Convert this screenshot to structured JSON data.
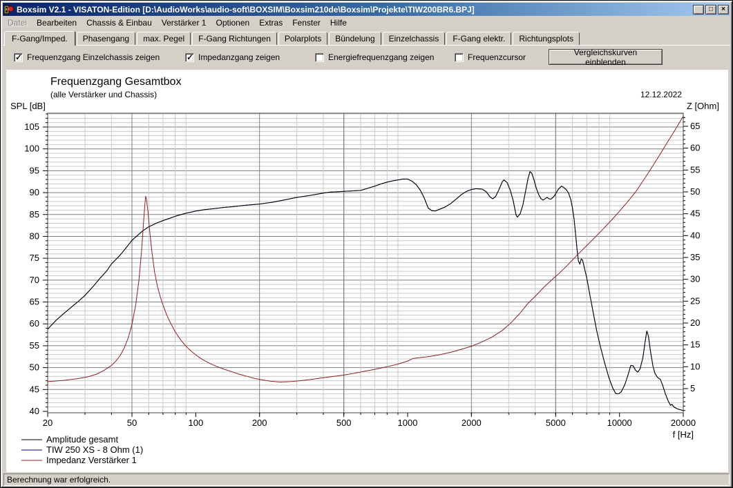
{
  "window": {
    "title": "Boxsim V2.1 - VISATON-Edition [D:\\AudioWorks\\audio-soft\\BOXSIM\\Boxsim210de\\Boxsim\\Projekte\\TIW200BR6.BPJ]",
    "controls": {
      "minimize": "_",
      "maximize": "□",
      "close": "×"
    }
  },
  "menu": {
    "items": [
      {
        "label": "Datei",
        "enabled": false
      },
      {
        "label": "Bearbeiten",
        "enabled": true
      },
      {
        "label": "Chassis & Einbau",
        "enabled": true
      },
      {
        "label": "Verstärker 1",
        "enabled": true
      },
      {
        "label": "Optionen",
        "enabled": true
      },
      {
        "label": "Extras",
        "enabled": true
      },
      {
        "label": "Fenster",
        "enabled": true
      },
      {
        "label": "Hilfe",
        "enabled": true
      }
    ]
  },
  "tabs": {
    "active_index": 0,
    "items": [
      "F-Gang/Imped.",
      "Phasengang",
      "max. Pegel",
      "F-Gang Richtungen",
      "Polarplots",
      "Bündelung",
      "Einzelchassis",
      "F-Gang elektr.",
      "Richtungsplots"
    ]
  },
  "controls": {
    "checkboxes": [
      {
        "label": "Frequenzgang Einzelchassis zeigen",
        "checked": true,
        "x": 16
      },
      {
        "label": "Impedanzgang zeigen",
        "checked": true,
        "x": 264
      },
      {
        "label": "Energiefrequenzgang zeigen",
        "checked": false,
        "x": 452
      },
      {
        "label": "Frequenzcursor",
        "checked": false,
        "x": 654
      }
    ],
    "compare_button": "Vergleichskurven einblenden"
  },
  "chart": {
    "title": "Frequenzgang Gesamtbox",
    "subtitle": "(alle Verstärker und Chassis)",
    "date": "12.12.2022",
    "y_left_label": "SPL [dB]",
    "y_right_label": "Z [Ohm]",
    "x_label": "f [Hz]"
  },
  "legend": {
    "items": [
      {
        "label": "Amplitude gesamt",
        "color": "#000000"
      },
      {
        "label": "TIW 250 XS - 8 Ohm (1)",
        "color": "#000080"
      },
      {
        "label": "Impedanz Verstärker 1",
        "color": "#8b2020"
      }
    ]
  },
  "status_bar": {
    "text": "Berechnung war erfolgreich."
  },
  "colors": {
    "window_bg": "#d4d0c8",
    "titlebar_left": "#0a246a",
    "titlebar_right": "#a6caf0",
    "chart_bg": "#ffffff",
    "grid_minor": "#c9c9c9",
    "grid_major": "#7d7d7d",
    "amplitude": "#000000",
    "chassis": "#000080",
    "impedance": "#8b2020"
  },
  "chart_data": {
    "type": "line",
    "title": "Frequenzgang Gesamtbox",
    "subtitle": "(alle Verstärker und Chassis)",
    "x_scale": "log",
    "x_range": [
      20,
      20000
    ],
    "x_ticks": [
      20,
      50,
      100,
      200,
      500,
      1000,
      2000,
      5000,
      10000,
      20000
    ],
    "xlabel": "f [Hz]",
    "y_left": {
      "label": "SPL [dB]",
      "tick_min": 40,
      "tick_max": 105,
      "tick_step": 5,
      "minor_step": 1
    },
    "y_right": {
      "label": "Z [Ohm]",
      "tick_min": 5,
      "tick_max": 65,
      "tick_step": 5,
      "minor_step": 1
    },
    "grid": true,
    "legend_position": "bottom-left",
    "series": [
      {
        "id": "tiw",
        "name": "TIW 250 XS - 8 Ohm (1)",
        "axis": "left",
        "color": "#000080",
        "points_ref": "amplitude",
        "note": "single-chassis curve coincides with total amplitude"
      },
      {
        "id": "amplitude",
        "name": "Amplitude gesamt",
        "axis": "left",
        "color": "#000000",
        "points": [
          [
            20,
            58.8
          ],
          [
            22,
            60.9
          ],
          [
            24,
            62.5
          ],
          [
            26,
            63.9
          ],
          [
            28,
            65.2
          ],
          [
            30,
            66.5
          ],
          [
            33,
            68.7
          ],
          [
            35,
            70.2
          ],
          [
            38,
            72.1
          ],
          [
            40,
            73.7
          ],
          [
            43,
            75.2
          ],
          [
            45,
            76.3
          ],
          [
            48,
            78.0
          ],
          [
            50,
            79.1
          ],
          [
            53,
            80.2
          ],
          [
            56,
            81.2
          ],
          [
            60,
            82.2
          ],
          [
            65,
            83.0
          ],
          [
            70,
            83.6
          ],
          [
            75,
            84.1
          ],
          [
            80,
            84.6
          ],
          [
            90,
            85.3
          ],
          [
            100,
            85.8
          ],
          [
            110,
            86.1
          ],
          [
            120,
            86.3
          ],
          [
            135,
            86.6
          ],
          [
            150,
            86.8
          ],
          [
            170,
            87.1
          ],
          [
            200,
            87.4
          ],
          [
            230,
            87.8
          ],
          [
            260,
            88.3
          ],
          [
            300,
            88.9
          ],
          [
            350,
            89.4
          ],
          [
            400,
            89.9
          ],
          [
            430,
            90.1
          ],
          [
            470,
            90.2
          ],
          [
            500,
            90.3
          ],
          [
            550,
            90.4
          ],
          [
            600,
            90.5
          ],
          [
            650,
            91.0
          ],
          [
            700,
            91.5
          ],
          [
            750,
            92.0
          ],
          [
            800,
            92.4
          ],
          [
            850,
            92.7
          ],
          [
            900,
            92.9
          ],
          [
            950,
            93.1
          ],
          [
            1000,
            93.1
          ],
          [
            1050,
            92.6
          ],
          [
            1100,
            91.8
          ],
          [
            1150,
            90.5
          ],
          [
            1200,
            88.7
          ],
          [
            1250,
            86.5
          ],
          [
            1300,
            85.9
          ],
          [
            1350,
            85.8
          ],
          [
            1400,
            86.1
          ],
          [
            1500,
            86.7
          ],
          [
            1600,
            87.5
          ],
          [
            1700,
            88.6
          ],
          [
            1800,
            89.6
          ],
          [
            1900,
            90.3
          ],
          [
            2000,
            90.7
          ],
          [
            2100,
            90.9
          ],
          [
            2250,
            90.8
          ],
          [
            2350,
            90.2
          ],
          [
            2450,
            89.0
          ],
          [
            2520,
            88.6
          ],
          [
            2600,
            89.1
          ],
          [
            2700,
            90.7
          ],
          [
            2800,
            92.5
          ],
          [
            2850,
            92.9
          ],
          [
            2950,
            92.3
          ],
          [
            3050,
            90.6
          ],
          [
            3150,
            88.2
          ],
          [
            3250,
            84.9
          ],
          [
            3300,
            84.4
          ],
          [
            3400,
            85.2
          ],
          [
            3500,
            87.2
          ],
          [
            3600,
            90.2
          ],
          [
            3700,
            93.2
          ],
          [
            3780,
            94.8
          ],
          [
            3860,
            94.4
          ],
          [
            3950,
            92.9
          ],
          [
            4050,
            91.0
          ],
          [
            4150,
            89.6
          ],
          [
            4250,
            88.7
          ],
          [
            4350,
            88.3
          ],
          [
            4450,
            88.6
          ],
          [
            4550,
            88.9
          ],
          [
            4650,
            88.6
          ],
          [
            4750,
            88.5
          ],
          [
            4850,
            88.9
          ],
          [
            4950,
            89.4
          ],
          [
            5050,
            90.1
          ],
          [
            5150,
            90.8
          ],
          [
            5330,
            91.5
          ],
          [
            5450,
            91.2
          ],
          [
            5600,
            90.7
          ],
          [
            5750,
            89.9
          ],
          [
            5900,
            88.3
          ],
          [
            6000,
            86.4
          ],
          [
            6100,
            84.0
          ],
          [
            6200,
            80.8
          ],
          [
            6300,
            77.3
          ],
          [
            6400,
            74.4
          ],
          [
            6500,
            73.7
          ],
          [
            6600,
            74.8
          ],
          [
            6700,
            74.6
          ],
          [
            6800,
            73.2
          ],
          [
            7000,
            70.6
          ],
          [
            7200,
            67.4
          ],
          [
            7500,
            62.8
          ],
          [
            7800,
            58.5
          ],
          [
            8100,
            55.1
          ],
          [
            8500,
            51.2
          ],
          [
            8900,
            47.8
          ],
          [
            9300,
            45.3
          ],
          [
            9600,
            44.1
          ],
          [
            9900,
            44.0
          ],
          [
            10200,
            44.5
          ],
          [
            10600,
            46.1
          ],
          [
            11000,
            48.5
          ],
          [
            11300,
            50.5
          ],
          [
            11600,
            50.4
          ],
          [
            11900,
            49.4
          ],
          [
            12200,
            49.0
          ],
          [
            12500,
            49.7
          ],
          [
            12900,
            52.3
          ],
          [
            13200,
            55.8
          ],
          [
            13450,
            58.4
          ],
          [
            13700,
            57.2
          ],
          [
            14000,
            53.8
          ],
          [
            14400,
            50.3
          ],
          [
            14700,
            48.7
          ],
          [
            15100,
            47.8
          ],
          [
            15600,
            47.3
          ],
          [
            16000,
            45.9
          ],
          [
            16500,
            43.9
          ],
          [
            17000,
            42.3
          ],
          [
            17400,
            41.4
          ],
          [
            17700,
            41.6
          ],
          [
            18100,
            41.0
          ],
          [
            18700,
            40.6
          ],
          [
            19300,
            40.4
          ],
          [
            20000,
            40.2
          ]
        ]
      },
      {
        "id": "impedance",
        "name": "Impedanz Verstärker 1",
        "axis": "right",
        "color": "#8b2020",
        "points": [
          [
            20,
            6.6
          ],
          [
            24,
            6.9
          ],
          [
            28,
            7.3
          ],
          [
            31,
            7.7
          ],
          [
            34,
            8.3
          ],
          [
            37,
            9.2
          ],
          [
            40,
            10.3
          ],
          [
            42,
            11.3
          ],
          [
            44,
            12.6
          ],
          [
            46,
            14.3
          ],
          [
            48,
            16.6
          ],
          [
            50,
            19.7
          ],
          [
            52,
            24.0
          ],
          [
            54,
            30.0
          ],
          [
            55.5,
            36.5
          ],
          [
            56.5,
            42.0
          ],
          [
            57.5,
            47.0
          ],
          [
            58,
            48.9
          ],
          [
            58.5,
            48.5
          ],
          [
            59.5,
            45.5
          ],
          [
            60.5,
            41.5
          ],
          [
            62,
            36.5
          ],
          [
            64,
            31.5
          ],
          [
            66,
            28.3
          ],
          [
            68,
            26.0
          ],
          [
            70,
            24.2
          ],
          [
            73,
            21.8
          ],
          [
            76,
            20.0
          ],
          [
            80,
            18.0
          ],
          [
            85,
            16.1
          ],
          [
            90,
            14.7
          ],
          [
            95,
            13.6
          ],
          [
            100,
            12.7
          ],
          [
            108,
            11.6
          ],
          [
            116,
            10.8
          ],
          [
            125,
            10.1
          ],
          [
            135,
            9.5
          ],
          [
            147,
            8.9
          ],
          [
            160,
            8.3
          ],
          [
            175,
            7.8
          ],
          [
            190,
            7.3
          ],
          [
            205,
            7.0
          ],
          [
            225,
            6.7
          ],
          [
            250,
            6.5
          ],
          [
            280,
            6.6
          ],
          [
            310,
            6.8
          ],
          [
            350,
            7.1
          ],
          [
            400,
            7.5
          ],
          [
            450,
            7.8
          ],
          [
            500,
            8.1
          ],
          [
            560,
            8.5
          ],
          [
            630,
            9.0
          ],
          [
            700,
            9.4
          ],
          [
            800,
            10.0
          ],
          [
            900,
            10.6
          ],
          [
            1000,
            11.3
          ],
          [
            1060,
            11.9
          ],
          [
            1150,
            12.1
          ],
          [
            1250,
            12.3
          ],
          [
            1400,
            12.7
          ],
          [
            1600,
            13.3
          ],
          [
            1800,
            14.0
          ],
          [
            2000,
            14.7
          ],
          [
            2250,
            15.7
          ],
          [
            2500,
            16.8
          ],
          [
            2800,
            18.3
          ],
          [
            3100,
            20.2
          ],
          [
            3400,
            22.3
          ],
          [
            3700,
            24.5
          ],
          [
            4000,
            26.1
          ],
          [
            4400,
            28.2
          ],
          [
            4800,
            29.9
          ],
          [
            5200,
            31.4
          ],
          [
            5700,
            33.3
          ],
          [
            6300,
            35.5
          ],
          [
            7000,
            37.7
          ],
          [
            7700,
            39.7
          ],
          [
            8400,
            41.6
          ],
          [
            9200,
            43.6
          ],
          [
            10000,
            45.6
          ],
          [
            11000,
            47.9
          ],
          [
            12000,
            50.2
          ],
          [
            13000,
            52.7
          ],
          [
            14000,
            55.1
          ],
          [
            15000,
            57.4
          ],
          [
            16000,
            59.6
          ],
          [
            17000,
            61.7
          ],
          [
            18000,
            63.6
          ],
          [
            19000,
            65.5
          ],
          [
            20000,
            67.3
          ]
        ]
      }
    ]
  }
}
